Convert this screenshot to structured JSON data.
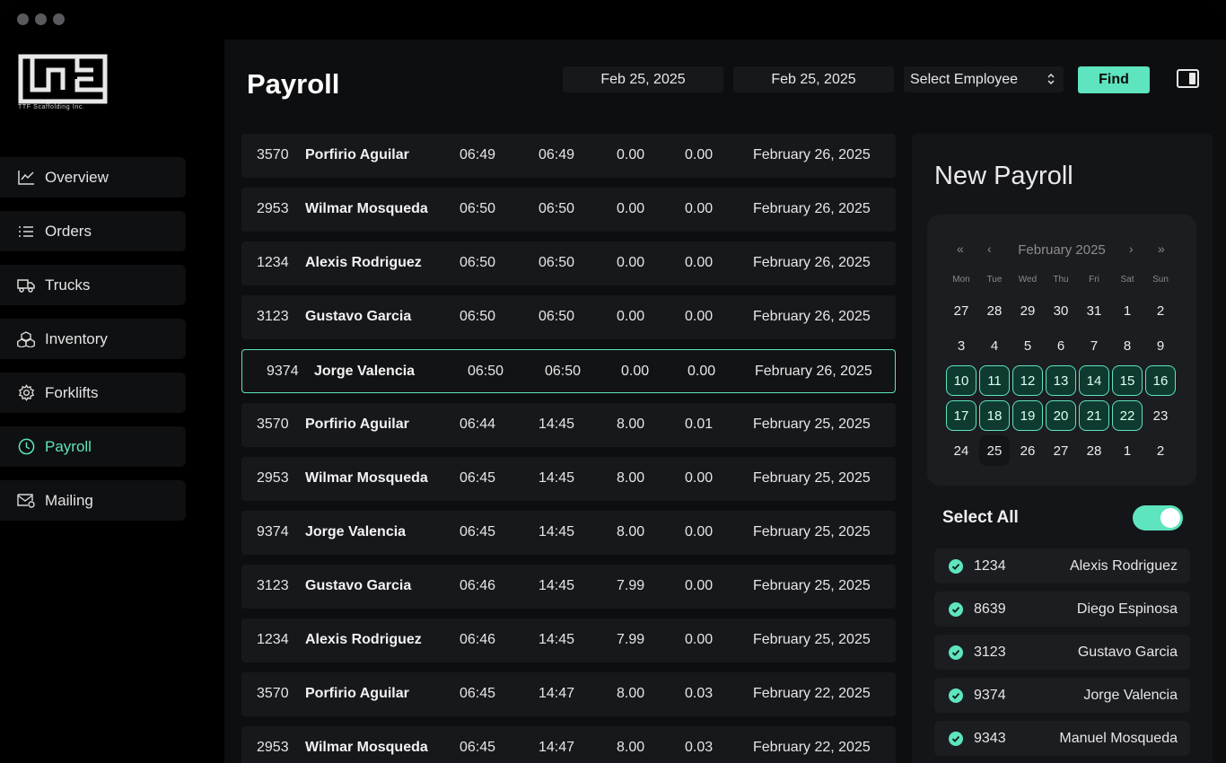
{
  "brand": {
    "logo_text": "TTF Scaffolding Inc."
  },
  "sidebar": {
    "items": [
      {
        "label": "Overview",
        "icon": "chart-line-icon",
        "active": false
      },
      {
        "label": "Orders",
        "icon": "list-icon",
        "active": false
      },
      {
        "label": "Trucks",
        "icon": "truck-icon",
        "active": false
      },
      {
        "label": "Inventory",
        "icon": "boxes-icon",
        "active": false
      },
      {
        "label": "Forklifts",
        "icon": "gear-icon",
        "active": false
      },
      {
        "label": "Payroll",
        "icon": "clock-icon",
        "active": true
      },
      {
        "label": "Mailing",
        "icon": "mail-icon",
        "active": false
      }
    ]
  },
  "header": {
    "title": "Payroll",
    "start_date": "Feb 25, 2025",
    "end_date": "Feb 25, 2025",
    "employee_select": "Select Employee",
    "find_label": "Find"
  },
  "table": {
    "rows": [
      {
        "id": "3570",
        "name": "Porfirio Aguilar",
        "in": "06:49",
        "out": "06:49",
        "h1": "0.00",
        "h2": "0.00",
        "date": "February 26, 2025"
      },
      {
        "id": "2953",
        "name": "Wilmar Mosqueda",
        "in": "06:50",
        "out": "06:50",
        "h1": "0.00",
        "h2": "0.00",
        "date": "February 26, 2025"
      },
      {
        "id": "1234",
        "name": "Alexis Rodriguez",
        "in": "06:50",
        "out": "06:50",
        "h1": "0.00",
        "h2": "0.00",
        "date": "February 26, 2025"
      },
      {
        "id": "3123",
        "name": "Gustavo Garcia",
        "in": "06:50",
        "out": "06:50",
        "h1": "0.00",
        "h2": "0.00",
        "date": "February 26, 2025"
      },
      {
        "id": "9374",
        "name": "Jorge Valencia",
        "in": "06:50",
        "out": "06:50",
        "h1": "0.00",
        "h2": "0.00",
        "date": "February 26, 2025",
        "selected": true
      },
      {
        "id": "3570",
        "name": "Porfirio Aguilar",
        "in": "06:44",
        "out": "14:45",
        "h1": "8.00",
        "h2": "0.01",
        "date": "February 25, 2025"
      },
      {
        "id": "2953",
        "name": "Wilmar Mosqueda",
        "in": "06:45",
        "out": "14:45",
        "h1": "8.00",
        "h2": "0.00",
        "date": "February 25, 2025"
      },
      {
        "id": "9374",
        "name": "Jorge Valencia",
        "in": "06:45",
        "out": "14:45",
        "h1": "8.00",
        "h2": "0.00",
        "date": "February 25, 2025"
      },
      {
        "id": "3123",
        "name": "Gustavo Garcia",
        "in": "06:46",
        "out": "14:45",
        "h1": "7.99",
        "h2": "0.00",
        "date": "February 25, 2025"
      },
      {
        "id": "1234",
        "name": "Alexis Rodriguez",
        "in": "06:46",
        "out": "14:45",
        "h1": "7.99",
        "h2": "0.00",
        "date": "February 25, 2025"
      },
      {
        "id": "3570",
        "name": "Porfirio Aguilar",
        "in": "06:45",
        "out": "14:47",
        "h1": "8.00",
        "h2": "0.03",
        "date": "February 22, 2025"
      },
      {
        "id": "2953",
        "name": "Wilmar Mosqueda",
        "in": "06:45",
        "out": "14:47",
        "h1": "8.00",
        "h2": "0.03",
        "date": "February 22, 2025"
      }
    ]
  },
  "new_payroll": {
    "title": "New Payroll",
    "calendar": {
      "month_label": "February 2025",
      "nav": {
        "prev_year": "«",
        "prev_month": "‹",
        "next_month": "›",
        "next_year": "»"
      },
      "weekdays": [
        "Mon",
        "Tue",
        "Wed",
        "Thu",
        "Fri",
        "Sat",
        "Sun"
      ],
      "weeks": [
        [
          "27",
          "28",
          "29",
          "30",
          "31",
          "1",
          "2"
        ],
        [
          "3",
          "4",
          "5",
          "6",
          "7",
          "8",
          "9"
        ],
        [
          "10",
          "11",
          "12",
          "13",
          "14",
          "15",
          "16"
        ],
        [
          "17",
          "18",
          "19",
          "20",
          "21",
          "22",
          "23"
        ],
        [
          "24",
          "25",
          "26",
          "27",
          "28",
          "1",
          "2"
        ]
      ],
      "selected_days": [
        "10",
        "11",
        "12",
        "13",
        "14",
        "15",
        "16",
        "17",
        "18",
        "19",
        "20",
        "21",
        "22"
      ],
      "today": "25"
    },
    "select_all_label": "Select All",
    "select_all_on": true,
    "employees": [
      {
        "id": "1234",
        "name": "Alexis Rodriguez",
        "checked": true
      },
      {
        "id": "8639",
        "name": "Diego Espinosa",
        "checked": true
      },
      {
        "id": "3123",
        "name": "Gustavo Garcia",
        "checked": true
      },
      {
        "id": "9374",
        "name": "Jorge Valencia",
        "checked": true
      },
      {
        "id": "9343",
        "name": "Manuel Mosqueda",
        "checked": true
      }
    ]
  },
  "colors": {
    "accent": "#5ee4be",
    "background": "#0d0e10",
    "sidebar": "#000000",
    "row": "#17181b"
  }
}
